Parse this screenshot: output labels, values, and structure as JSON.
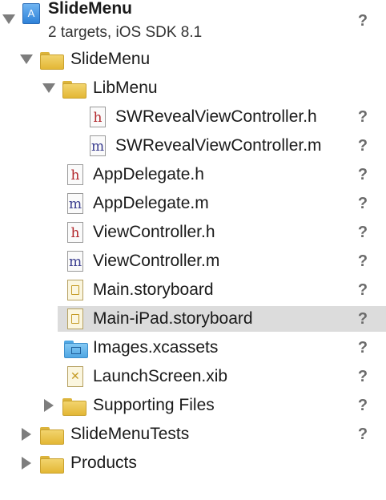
{
  "project": {
    "name": "SlideMenu",
    "subtitle": "2 targets, iOS SDK 8.1",
    "status": "?"
  },
  "tree": {
    "slidemenu_group": {
      "label": "SlideMenu"
    },
    "libmenu_group": {
      "label": "LibMenu"
    },
    "sw_h": {
      "label": "SWRevealViewController.h",
      "status": "?",
      "icon": "header-file-icon"
    },
    "sw_m": {
      "label": "SWRevealViewController.m",
      "status": "?",
      "icon": "source-file-icon"
    },
    "appdelegate_h": {
      "label": "AppDelegate.h",
      "status": "?",
      "icon": "header-file-icon"
    },
    "appdelegate_m": {
      "label": "AppDelegate.m",
      "status": "?",
      "icon": "source-file-icon"
    },
    "viewcontroller_h": {
      "label": "ViewController.h",
      "status": "?",
      "icon": "header-file-icon"
    },
    "viewcontroller_m": {
      "label": "ViewController.m",
      "status": "?",
      "icon": "source-file-icon"
    },
    "main_storyboard": {
      "label": "Main.storyboard",
      "status": "?",
      "icon": "storyboard-file-icon"
    },
    "main_ipad_storyboard": {
      "label": "Main-iPad.storyboard",
      "status": "?",
      "icon": "storyboard-file-icon",
      "selected": true
    },
    "images_xcassets": {
      "label": "Images.xcassets",
      "status": "?",
      "icon": "asset-catalog-icon"
    },
    "launchscreen_xib": {
      "label": "LaunchScreen.xib",
      "status": "?",
      "icon": "xib-file-icon"
    },
    "supporting_files": {
      "label": "Supporting Files",
      "status": "?"
    },
    "slidemenutests": {
      "label": "SlideMenuTests",
      "status": "?"
    },
    "products": {
      "label": "Products"
    }
  },
  "glyphs": {
    "header": "h",
    "source": "m",
    "xib": "✕",
    "project": "A"
  },
  "colors": {
    "selection": "#dcdcdc",
    "folder": "#e8c24a",
    "asset_folder": "#5aaee8",
    "header_glyph": "#b2282d",
    "source_glyph": "#3a3d8f",
    "status": "#6b6b6b"
  }
}
